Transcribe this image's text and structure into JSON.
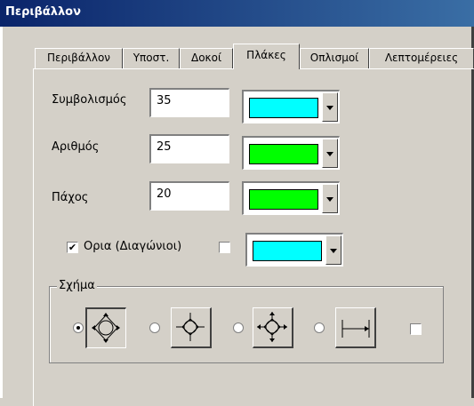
{
  "window": {
    "title": "Περιβάλλον"
  },
  "tabs": [
    "Περιβάλλον",
    "Υποστ.",
    "Δοκοί",
    "Πλάκες",
    "Οπλισμοί",
    "Λεπτομέρειες"
  ],
  "active_tab": "Πλάκες",
  "fields": {
    "symbolism": {
      "label": "Συμβολισμός",
      "value": "35",
      "color": "#00ffff"
    },
    "number": {
      "label": "Αριθμός",
      "value": "25",
      "color": "#00ff00"
    },
    "thickness": {
      "label": "Πάχος",
      "value": "20",
      "color": "#00ff00"
    }
  },
  "borders": {
    "label": "Ορια (Διαγώνιοι)",
    "checked": true,
    "second_checked": false,
    "color": "#00ffff"
  },
  "shape_group": {
    "label": "Σχήμα",
    "selected_index": 0,
    "options": [
      "diamond-arrows-icon",
      "diamond-plain-icon",
      "diamond-arrows-small-icon",
      "line-icon"
    ],
    "extra_checkbox_checked": false
  }
}
